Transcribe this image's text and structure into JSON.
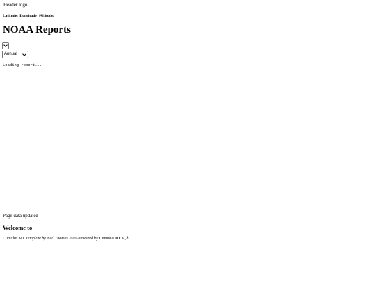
{
  "header": {
    "logo_alt": "Header logo"
  },
  "location": {
    "latitude_label": "Latitude:",
    "separator1": "|",
    "longitude_label": "Longitude:",
    "separator2": "|",
    "altitude_label": "Altitude:"
  },
  "page": {
    "title": "NOAA Reports"
  },
  "controls": {
    "report_select_value": "",
    "period_select_value": "Annual"
  },
  "report": {
    "content": "Loading report..."
  },
  "status": {
    "updated_prefix": "Page data updated",
    "updated_suffix": "."
  },
  "welcome": {
    "text": "Welcome to"
  },
  "footer": {
    "credit": "Cumulus MX Template by Neil Thomas 2026 Powered by Cumulus MX v., b."
  },
  "icons": {
    "broken_image": "broken-image-icon",
    "dropdown": "chevron-down-icon"
  }
}
